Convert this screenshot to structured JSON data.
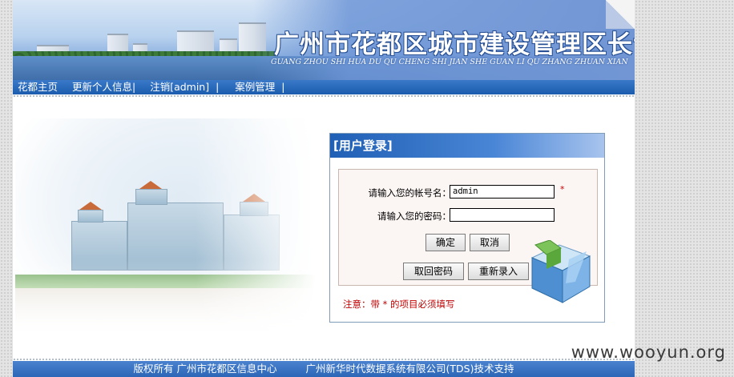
{
  "banner": {
    "title": "广州市花都区城市建设管理区长专线",
    "subtitle": "GUANG ZHOU SHI HUA DU QU CHENG SHI JIAN SHE GUAN LI QU ZHANG ZHUAN XIAN"
  },
  "nav": {
    "items": [
      {
        "label": "花都主页"
      },
      {
        "label": "更新个人信息"
      },
      {
        "label": "注销[admin]"
      },
      {
        "label": "案例管理"
      }
    ],
    "separator": "|"
  },
  "login": {
    "title": "[用户登录]",
    "username_label": "请输入您的帐号名：",
    "username_value": "admin",
    "password_label": "请输入您的密码：",
    "password_value": "",
    "required_mark": "*",
    "confirm_button": "确定",
    "cancel_button": "取消",
    "retrieve_password_button": "取回密码",
    "relogin_button": "重新录入",
    "note": "注意：带 * 的项目必须填写"
  },
  "footer": {
    "copyright": "版权所有  广州市花都区信息中心",
    "support": "广州新华时代数据系统有限公司(TDS)技术支持"
  },
  "watermark": "www.wooyun.org",
  "colors": {
    "nav_blue": "#1b5cae",
    "required_red": "#d00000",
    "note_red": "#c00000"
  }
}
